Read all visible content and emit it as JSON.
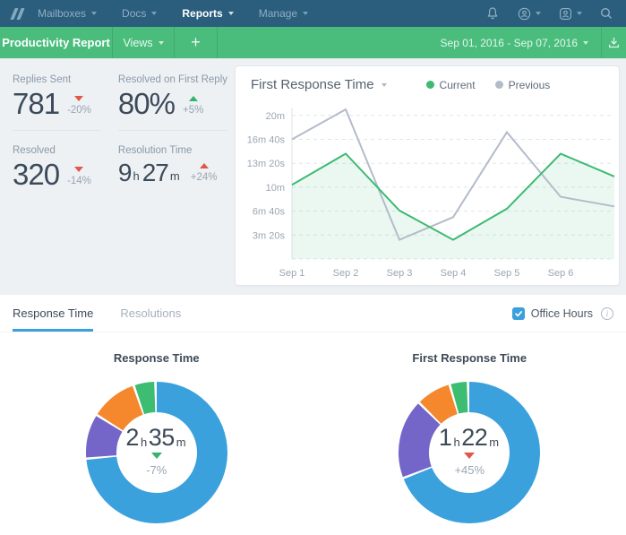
{
  "navbar": {
    "items": [
      {
        "label": "Mailboxes",
        "active": false
      },
      {
        "label": "Docs",
        "active": false
      },
      {
        "label": "Reports",
        "active": true
      },
      {
        "label": "Manage",
        "active": false
      }
    ],
    "right_icons": [
      "bell-icon",
      "account-avatar-circle-icon",
      "user-avatar-square-icon",
      "search-icon"
    ]
  },
  "toolbar": {
    "title": "Productivity Report",
    "views_label": "Views",
    "add_label": "+",
    "date_range": "Sep 01, 2016 - Sep 07, 2016",
    "download_icon": "download-icon"
  },
  "stats": [
    {
      "label": "Replies Sent",
      "value": "781",
      "delta": "-20%",
      "trend": "down",
      "trend_color": "#e0574b"
    },
    {
      "label": "Resolved on First Reply",
      "value": "80%",
      "delta": "+5%",
      "trend": "up",
      "trend_color": "#36b26c"
    },
    {
      "label": "Resolved",
      "value": "320",
      "delta": "-14%",
      "trend": "down",
      "trend_color": "#e0574b"
    },
    {
      "label": "Resolution Time",
      "value_hours": "9",
      "hours_unit": "h",
      "value_minutes": "27",
      "minutes_unit": "m",
      "delta": "+24%",
      "trend": "up",
      "trend_color": "#e0574b"
    }
  ],
  "chart_data": [
    {
      "type": "line",
      "title": "First Response Time",
      "legend": [
        {
          "label": "Current",
          "color": "#3eba72"
        },
        {
          "label": "Previous",
          "color": "#b3bcc9"
        }
      ],
      "legend_position": "top",
      "grid": "dashed",
      "x_labels": [
        "Sep 1",
        "Sep 2",
        "Sep 3",
        "Sep 4",
        "Sep 5",
        "Sep 6"
      ],
      "x_points": [
        "Sep 1",
        "Sep 2",
        "Sep 3",
        "Sep 4",
        "Sep 5",
        "Sep 6",
        "Sep 7"
      ],
      "y_ticks": [
        {
          "label": "20m",
          "seconds": 1200
        },
        {
          "label": "16m 40s",
          "seconds": 1000
        },
        {
          "label": "13m 20s",
          "seconds": 800
        },
        {
          "label": "10m",
          "seconds": 600
        },
        {
          "label": "6m 40s",
          "seconds": 400
        },
        {
          "label": "3m 20s",
          "seconds": 200
        }
      ],
      "ylim_seconds": [
        0,
        1300
      ],
      "series": [
        {
          "name": "Current",
          "color": "#3eba72",
          "area_fill": "rgba(62,186,114,0.10)",
          "values_seconds": [
            620,
            880,
            405,
            160,
            420,
            880,
            690
          ]
        },
        {
          "name": "Previous",
          "color": "#b3bcc9",
          "values_seconds": [
            1000,
            1250,
            160,
            350,
            1060,
            520,
            440
          ]
        }
      ]
    },
    {
      "type": "pie",
      "title": "Response Time",
      "center": {
        "hours": "2",
        "hours_unit": "h",
        "minutes": "35",
        "minutes_unit": "m"
      },
      "delta": "-7%",
      "trend": "down",
      "trend_color": "#36b26c",
      "segments": [
        {
          "name": "blue",
          "color": "#3ba1dc",
          "pct": 73.9
        },
        {
          "name": "purple",
          "color": "#7466c9",
          "pct": 10.3
        },
        {
          "name": "orange",
          "color": "#f5872d",
          "pct": 10.8
        },
        {
          "name": "green",
          "color": "#3dbd71",
          "pct": 5.0
        }
      ]
    },
    {
      "type": "pie",
      "title": "First Response Time",
      "center": {
        "hours": "1",
        "hours_unit": "h",
        "minutes": "22",
        "minutes_unit": "m"
      },
      "delta": "+45%",
      "trend": "down",
      "trend_color": "#e0574b",
      "segments": [
        {
          "name": "blue",
          "color": "#3ba1dc",
          "pct": 69.4
        },
        {
          "name": "purple",
          "color": "#7466c9",
          "pct": 18.3
        },
        {
          "name": "orange",
          "color": "#f5872d",
          "pct": 8.1
        },
        {
          "name": "green",
          "color": "#3dbd71",
          "pct": 4.2
        }
      ]
    }
  ],
  "tabs": {
    "items": [
      {
        "label": "Response Time",
        "active": true
      },
      {
        "label": "Resolutions",
        "active": false
      }
    ],
    "office_hours": {
      "label": "Office Hours",
      "checked": true,
      "info_icon": "info-icon"
    }
  },
  "colors": {
    "navbar_bg": "#2b5d7c",
    "toolbar_green": "#4abd7d",
    "accent_blue": "#3a9fdc",
    "current_green": "#3eba72",
    "previous_gray": "#b3bcc9",
    "negative_red": "#e0574b",
    "positive_green": "#36b26c",
    "panel_bg": "#edf1f4"
  }
}
